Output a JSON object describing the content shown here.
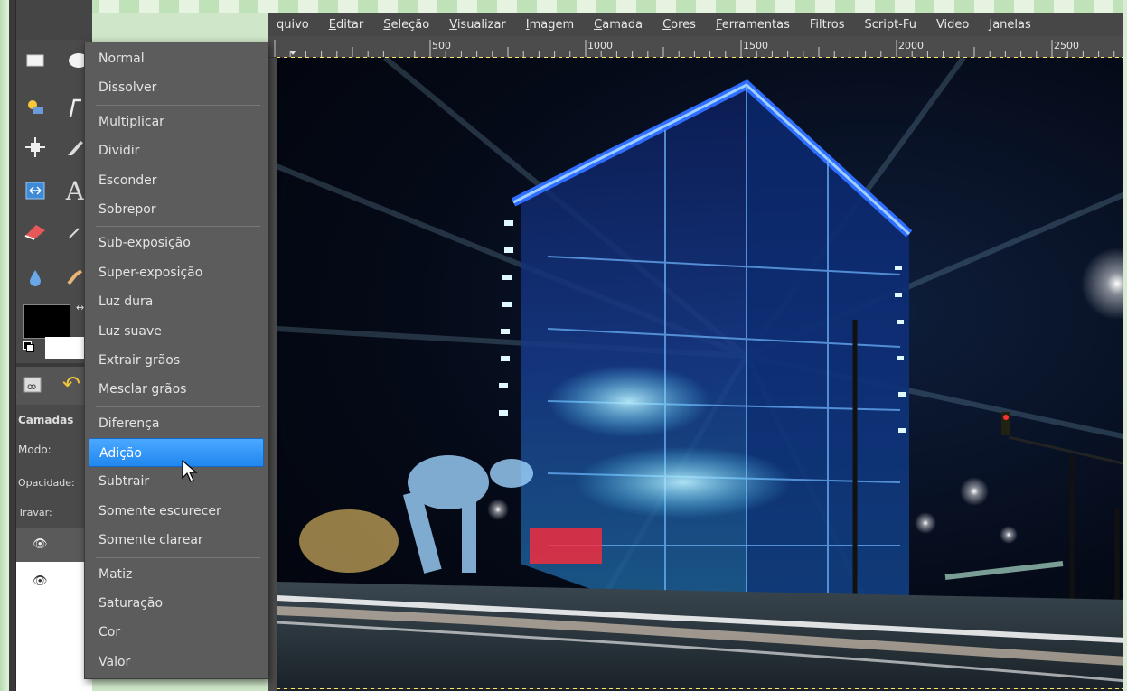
{
  "menubar": {
    "items": [
      {
        "label": "quivo",
        "u": ""
      },
      {
        "label": "Editar",
        "u": "E"
      },
      {
        "label": "Seleção",
        "u": "S"
      },
      {
        "label": "Visualizar",
        "u": "V"
      },
      {
        "label": "Imagem",
        "u": "I"
      },
      {
        "label": "Camada",
        "u": "C"
      },
      {
        "label": "Cores",
        "u": "C"
      },
      {
        "label": "Ferramentas",
        "u": "F"
      },
      {
        "label": "Filtros",
        "u": ""
      },
      {
        "label": "Script-Fu",
        "u": ""
      },
      {
        "label": "Video",
        "u": ""
      },
      {
        "label": "Janelas",
        "u": ""
      }
    ]
  },
  "ruler": {
    "labels": [
      "500",
      "1000",
      "1500",
      "2000",
      "2500"
    ]
  },
  "layers_panel": {
    "title": "Camadas",
    "mode_label": "Modo:",
    "opacity_label": "Opacidade:",
    "lock_label": "Travar:"
  },
  "mode_menu": {
    "groups": [
      [
        "Normal",
        "Dissolver"
      ],
      [
        "Multiplicar",
        "Dividir",
        "Esconder",
        "Sobrepor"
      ],
      [
        "Sub-exposição",
        "Super-exposição",
        "Luz dura",
        "Luz suave",
        "Extrair grãos",
        "Mesclar grãos"
      ],
      [
        "Diferença",
        "Adição",
        "Subtrair",
        "Somente escurecer",
        "Somente clarear"
      ],
      [
        "Matiz",
        "Saturação",
        "Cor",
        "Valor"
      ]
    ],
    "selected": "Adição"
  },
  "colors": {
    "selection_accent": "#2187ef",
    "foreground": "#000000",
    "background": "#ffffff"
  }
}
